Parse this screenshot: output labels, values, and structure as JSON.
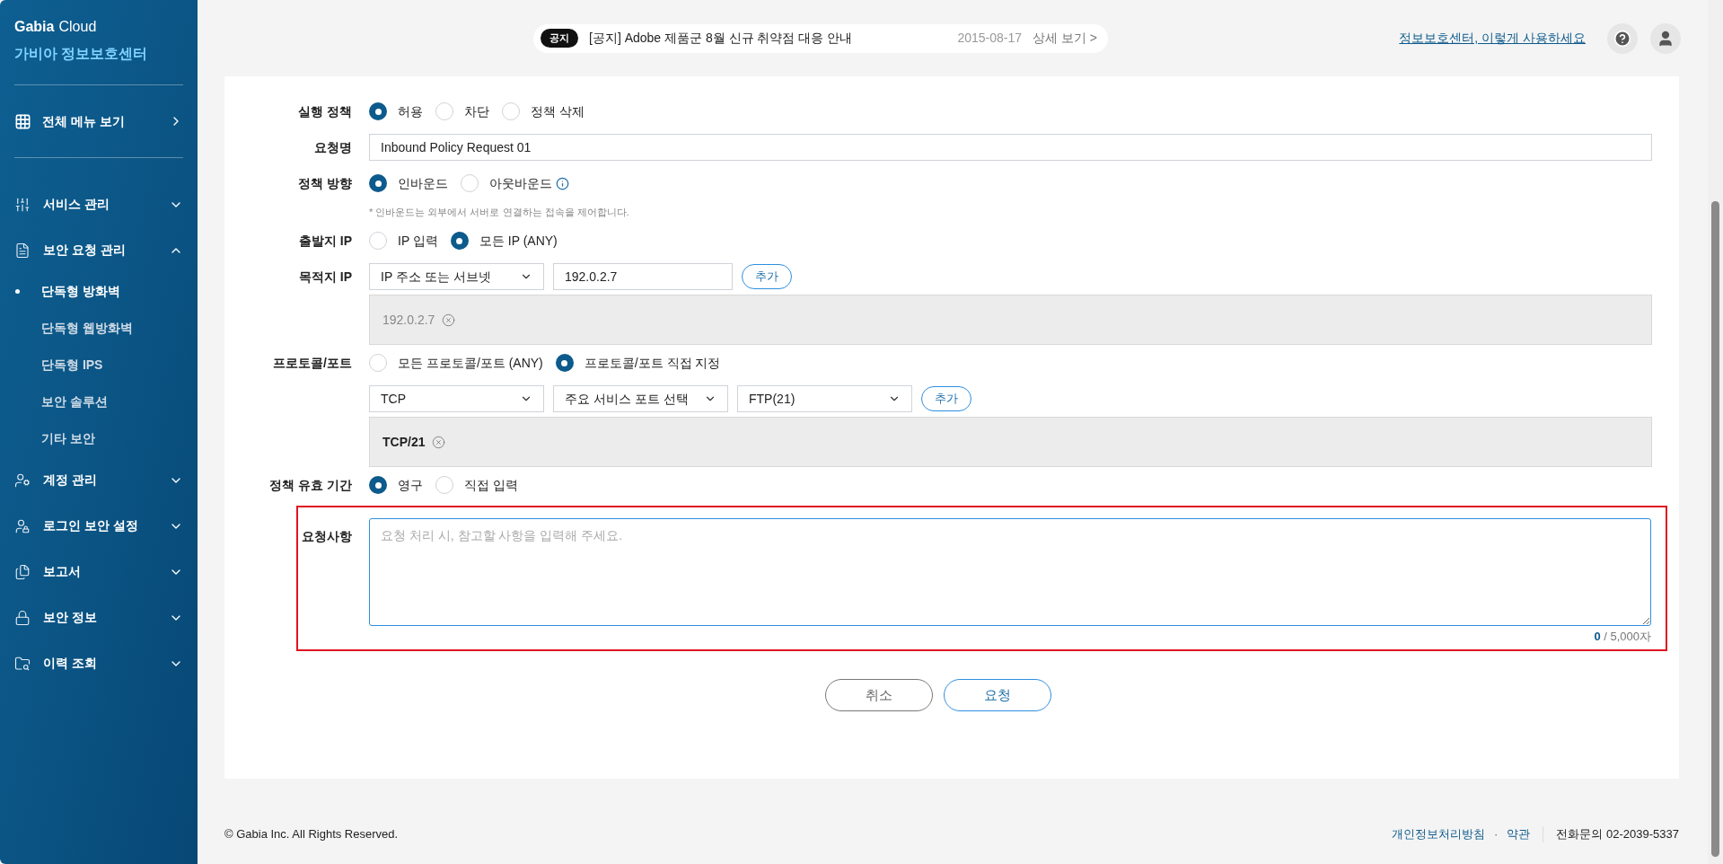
{
  "sidebar": {
    "brand_bold": "Gabia",
    "brand_light": "Cloud",
    "brand_ko": "가비아 정보보호센터",
    "all_menu": "전체 메뉴 보기",
    "items": [
      {
        "label": "서비스 관리",
        "expanded": false
      },
      {
        "label": "보안 요청 관리",
        "expanded": true,
        "children": [
          {
            "label": "단독형 방화벽",
            "selected": true
          },
          {
            "label": "단독형 웹방화벽",
            "selected": false
          },
          {
            "label": "단독형 IPS",
            "selected": false
          },
          {
            "label": "보안 솔루션",
            "selected": false
          },
          {
            "label": "기타 보안",
            "selected": false
          }
        ]
      },
      {
        "label": "계정 관리",
        "expanded": false
      },
      {
        "label": "로그인 보안 설정",
        "expanded": false
      },
      {
        "label": "보고서",
        "expanded": false
      },
      {
        "label": "보안 정보",
        "expanded": false
      },
      {
        "label": "이력 조회",
        "expanded": false
      }
    ]
  },
  "header": {
    "notice_badge": "공지",
    "notice": "[공지] Adobe 제품군 8월 신규 취약점 대응 안내",
    "notice_date": "2015-08-17",
    "notice_more": "상세 보기 >",
    "guide_link": "정보보호센터, 이렇게 사용하세요"
  },
  "form": {
    "rows": [
      {
        "kind": "radio",
        "label": "실행 정책",
        "options": [
          {
            "label": "허용",
            "selected": true
          },
          {
            "label": "차단",
            "selected": false
          },
          {
            "label": "정책 삭제",
            "selected": false
          }
        ]
      },
      {
        "kind": "text",
        "label": "요청명",
        "value": "Inbound Policy Request 01"
      },
      {
        "kind": "radio",
        "label": "정책 방향",
        "options": [
          {
            "label": "인바운드",
            "selected": true
          },
          {
            "label": "아웃바운드",
            "selected": false,
            "info": true
          }
        ],
        "note": "* 인바운드는 외부에서 서버로 연결하는 접속을 제어합니다."
      },
      {
        "kind": "radio",
        "label": "출발지 IP",
        "options": [
          {
            "label": "IP 입력",
            "selected": false
          },
          {
            "label": "모든 IP (ANY)",
            "selected": true
          }
        ]
      },
      {
        "kind": "inputs",
        "label": "목적지 IP",
        "fields": [
          {
            "kind": "select",
            "value": "IP 주소 또는 서브넷"
          },
          {
            "kind": "text",
            "value": "192.0.2.7"
          }
        ],
        "add": "추가",
        "tags": [
          {
            "label": "192.0.2.7",
            "muted": true
          }
        ]
      },
      {
        "kind": "radio",
        "label": "프로토콜/포트",
        "options": [
          {
            "label": "모든 프로토콜/포트 (ANY)",
            "selected": false
          },
          {
            "label": "프로토콜/포트 직접 지정",
            "selected": true
          }
        ]
      },
      {
        "kind": "inputs",
        "fields": [
          {
            "kind": "select",
            "value": "TCP"
          },
          {
            "kind": "select",
            "value": "주요 서비스 포트 선택"
          },
          {
            "kind": "select",
            "value": "FTP(21)"
          }
        ],
        "add": "추가",
        "tags": [
          {
            "label": "TCP/21",
            "muted": false
          }
        ]
      },
      {
        "kind": "radio",
        "label": "정책 유효 기간",
        "options": [
          {
            "label": "영구",
            "selected": true
          },
          {
            "label": "직접 입력",
            "selected": false
          }
        ]
      }
    ],
    "request": {
      "label": "요청사항",
      "placeholder": "요청 처리 시, 참고할 사항을 입력해 주세요.",
      "count": "0",
      "limit": " / 5,000자",
      "highlighted": true
    }
  },
  "actions": [
    {
      "label": "취소",
      "kind": "secondary"
    },
    {
      "label": "요청",
      "kind": "primary"
    }
  ],
  "footer": {
    "copyright": "© Gabia Inc. All Rights Reserved.",
    "links": [
      "개인정보처리방침",
      "약관"
    ],
    "separator": "·",
    "phone": "전화문의 02-2039-5337"
  }
}
